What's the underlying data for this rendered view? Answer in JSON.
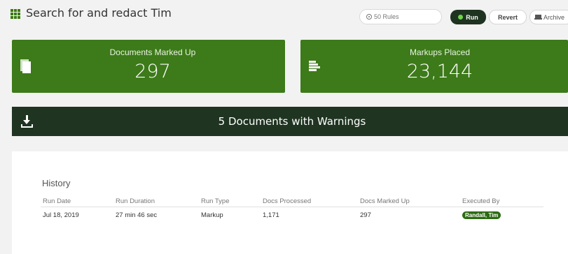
{
  "header": {
    "title": "Search for and redact Tim",
    "rules_label": "50 Rules",
    "run_label": "Run",
    "revert_label": "Revert",
    "archive_label": "Archive"
  },
  "stats": {
    "documents_marked_up": {
      "label": "Documents Marked Up",
      "value": "297"
    },
    "markups_placed": {
      "label": "Markups Placed",
      "value": "23,144"
    }
  },
  "warnings": {
    "label": "5 Documents with Warnings"
  },
  "history": {
    "title": "History",
    "columns": [
      "Run Date",
      "Run Duration",
      "Run Type",
      "Docs Processed",
      "Docs Marked Up",
      "Executed By"
    ],
    "rows": [
      [
        "Jul 18, 2019",
        "27 min 46 sec",
        "Markup",
        "1,171",
        "297",
        "Randall, Tim"
      ]
    ]
  },
  "colors": {
    "brand_green": "#3d7a1a",
    "dark_green": "#1f3421",
    "run_dot": "#6fd34a"
  },
  "icons": [
    "grid-icon",
    "settings-icon",
    "archive-icon",
    "document-icon",
    "lines-icon",
    "download-icon"
  ]
}
